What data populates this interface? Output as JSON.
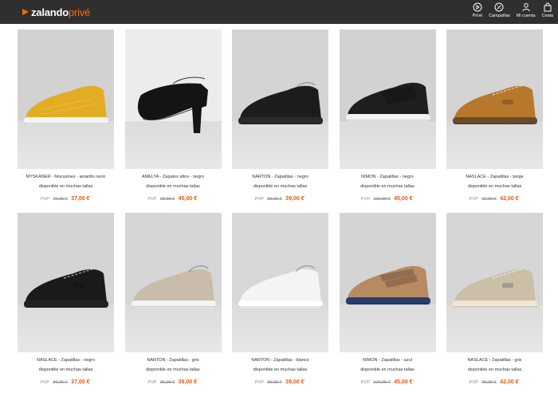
{
  "brand": {
    "name_main": "zalando",
    "name_accent": "privé",
    "accent_color": "#ff6900"
  },
  "nav": [
    {
      "label": "Privé",
      "icon": "play-icon"
    },
    {
      "label": "Campañas",
      "icon": "campaigns-icon"
    },
    {
      "label": "Mi cuenta",
      "icon": "user-icon"
    },
    {
      "label": "Cesta",
      "icon": "bag-icon"
    }
  ],
  "products": [
    {
      "title": "MYSKANER - Mocasines - amarillo neón",
      "availability": "disponible en muchas tallas",
      "pvp_label": "PVP",
      "old_price": "79,95 €",
      "price": "37,00 €",
      "price_marker": "*",
      "shoe_color": "#e2ad22",
      "sole_color": "#f4f4f4",
      "shoe_type": "moccasin",
      "bg": "#d2d2d2"
    },
    {
      "title": "AMELYA - Zapatos altos - negro",
      "availability": "disponible en muchas tallas",
      "pvp_label": "PVP",
      "old_price": "99,95 €",
      "price": "45,00 €",
      "price_marker": "*",
      "shoe_color": "#141414",
      "sole_color": "#1d1d1d",
      "shoe_type": "heel",
      "bg": "#ececec"
    },
    {
      "title": "NARTON - Zapatillas - negro",
      "availability": "disponible en muchas tallas",
      "pvp_label": "PVP",
      "old_price": "89,95 €",
      "price": "39,00 €",
      "price_marker": "*",
      "shoe_color": "#1c1c1c",
      "sole_color": "#2a2a2a",
      "shoe_type": "slipon",
      "bg": "#d4d4d4"
    },
    {
      "title": "NIMON - Zapatillas - negro",
      "availability": "disponible en muchas tallas",
      "pvp_label": "PVP",
      "old_price": "109,95 €",
      "price": "45,00 €",
      "price_marker": "*",
      "shoe_color": "#1e1e1e",
      "sole_color": "#f2f2f2",
      "shoe_type": "velcro",
      "bg": "#d2d2d2"
    },
    {
      "title": "NASLACE - Zapatillas - beige",
      "availability": "disponible en muchas tallas",
      "pvp_label": "PVP",
      "old_price": "99,95 €",
      "price": "42,00 €",
      "price_marker": "*",
      "shoe_color": "#b8782c",
      "sole_color": "#6b4a2b",
      "shoe_type": "lace",
      "bg": "#d4d4d4"
    },
    {
      "title": "NASLACE - Zapatillas - negro",
      "availability": "disponible en muchas tallas",
      "pvp_label": "PVP",
      "old_price": "89,95 €",
      "price": "37,00 €",
      "price_marker": "*",
      "shoe_color": "#1a1a1a",
      "sole_color": "#222222",
      "shoe_type": "lace",
      "bg": "#d4d4d4"
    },
    {
      "title": "NARTON - Zapatillas - gris",
      "availability": "disponible en muchas tallas",
      "pvp_label": "PVP",
      "old_price": "89,95 €",
      "price": "39,00 €",
      "price_marker": "*",
      "shoe_color": "#c9bcaa",
      "sole_color": "#f3f3f3",
      "shoe_type": "slipon",
      "bg": "#d6d6d6"
    },
    {
      "title": "NARTON - Zapatillas - blanco",
      "availability": "disponible en muchas tallas",
      "pvp_label": "PVP",
      "old_price": "89,95 €",
      "price": "39,00 €",
      "price_marker": "*",
      "shoe_color": "#f4f4f4",
      "sole_color": "#ffffff",
      "shoe_type": "slipon",
      "bg": "#d8d8d8"
    },
    {
      "title": "NIMON - Zapatillas - azul",
      "availability": "disponible en muchas tallas",
      "pvp_label": "PVP",
      "old_price": "109,95 €",
      "price": "45,00 €",
      "price_marker": "*",
      "shoe_color": "#b78a62",
      "sole_color": "#2b3d6b",
      "shoe_type": "velcro",
      "bg": "#d4d4d4"
    },
    {
      "title": "NASLACE - Zapatillas - gris",
      "availability": "disponible en muchas tallas",
      "pvp_label": "PVP",
      "old_price": "99,95 €",
      "price": "42,00 €",
      "price_marker": "*",
      "shoe_color": "#cbbfa8",
      "sole_color": "#efe6d6",
      "shoe_type": "lace",
      "bg": "#d6d6d6"
    }
  ]
}
